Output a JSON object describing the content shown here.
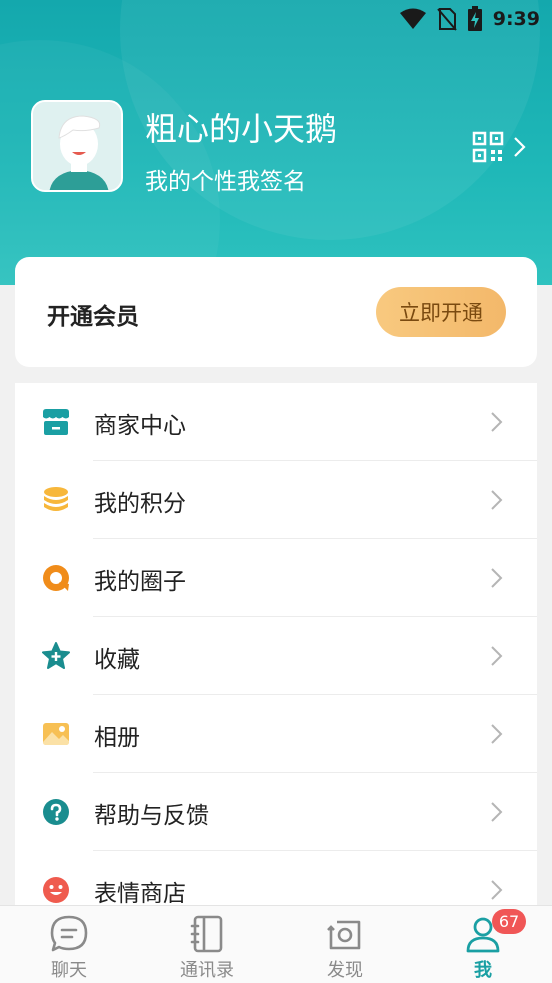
{
  "status_bar": {
    "time": "9:39"
  },
  "profile": {
    "username": "粗心的小天鹅",
    "signature": "我的个性我签名"
  },
  "member": {
    "title": "开通会员",
    "button": "立即开通"
  },
  "menu": {
    "items": [
      {
        "label": "商家中心",
        "icon": "store-icon"
      },
      {
        "label": "我的积分",
        "icon": "coins-icon"
      },
      {
        "label": "我的圈子",
        "icon": "circle-chat-icon"
      },
      {
        "label": "收藏",
        "icon": "star-icon"
      },
      {
        "label": "相册",
        "icon": "album-icon"
      },
      {
        "label": "帮助与反馈",
        "icon": "help-icon"
      },
      {
        "label": "表情商店",
        "icon": "smiley-icon"
      }
    ]
  },
  "tabs": [
    {
      "label": "聊天",
      "icon": "chat-icon"
    },
    {
      "label": "通讯录",
      "icon": "contacts-icon"
    },
    {
      "label": "发现",
      "icon": "discover-icon"
    },
    {
      "label": "我",
      "icon": "profile-icon",
      "active": true,
      "badge": "67"
    }
  ],
  "colors": {
    "accent": "#1a9fa3",
    "header": "#1fb8b8",
    "member_button": "#f3b86a",
    "badge": "#f05656"
  }
}
